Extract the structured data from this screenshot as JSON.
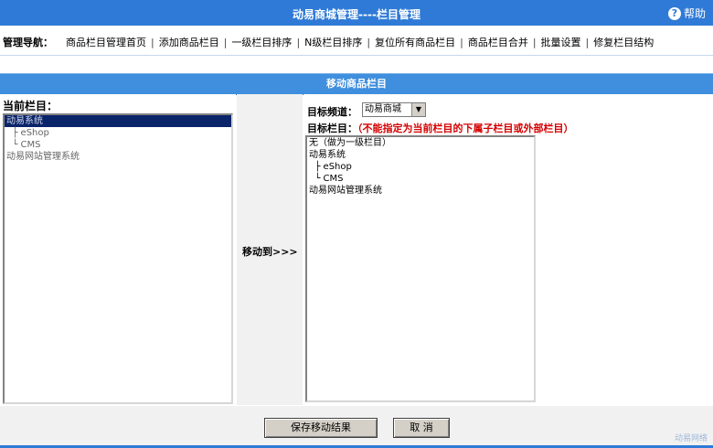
{
  "title": "动易商城管理----栏目管理",
  "help_label": "帮助",
  "nav": {
    "label": "管理导航：",
    "items": [
      "商品栏目管理首页",
      "添加商品栏目",
      "一级栏目排序",
      "N级栏目排序",
      "复位所有商品栏目",
      "商品栏目合并",
      "批量设置",
      "修复栏目结构"
    ]
  },
  "section_title": "移动商品栏目",
  "current": {
    "label": "当前栏目：",
    "options": [
      "动易系统",
      "  ├ eShop",
      "  └ CMS",
      "动易网站管理系统"
    ]
  },
  "move_to": "移动到>>>",
  "target_channel": {
    "label": "目标频道：",
    "value": "动易商城"
  },
  "target_column": {
    "label": "目标栏目：",
    "warning": "（不能指定为当前栏目的下属子栏目或外部栏目）",
    "options": [
      "无（做为一级栏目）",
      "动易系统",
      "  ├ eShop",
      "  └ CMS",
      "动易网站管理系统"
    ]
  },
  "buttons": {
    "save": "保存移动结果",
    "cancel": "取 消"
  },
  "copyright": "动易网络"
}
